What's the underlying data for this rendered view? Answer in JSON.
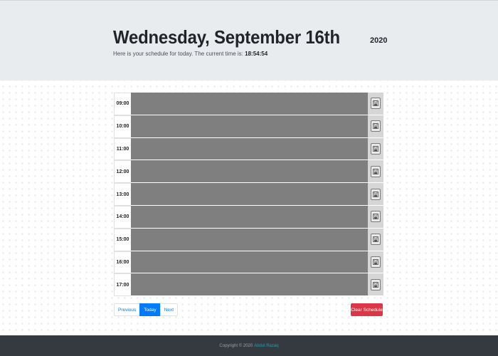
{
  "header": {
    "title": "Wednesday, September 16th",
    "year": "2020",
    "lead_prefix": "Here is your schedule for today. The current time is: ",
    "current_time": "18:54:54"
  },
  "schedule": {
    "hours": [
      "09:00",
      "10:00",
      "11:00",
      "12:00",
      "13:00",
      "14:00",
      "15:00",
      "16:00",
      "17:00"
    ],
    "descriptions": [
      "",
      "",
      "",
      "",
      "",
      "",
      "",
      "",
      ""
    ],
    "row_color_past": "#7f7f7f",
    "save_icon": "save-icon"
  },
  "pagination": {
    "previous": "Previous",
    "today": "Today",
    "next": "Next"
  },
  "actions": {
    "clear_label": "Clear Schedule",
    "clear_color": "#dc3545"
  },
  "footer": {
    "copyright": "Copyright © 2020",
    "author": "Abdul Razaq"
  }
}
